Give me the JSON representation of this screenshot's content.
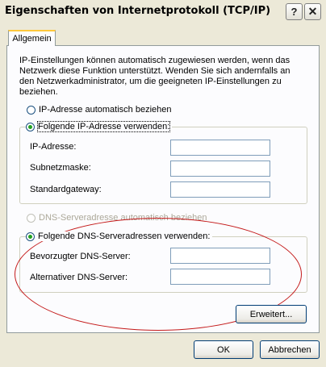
{
  "window": {
    "title": "Eigenschaften von Internetprotokoll (TCP/IP)",
    "help_icon": "?",
    "close_icon": "✕"
  },
  "tabs": [
    {
      "label": "Allgemein"
    }
  ],
  "intro_text": "IP-Einstellungen können automatisch zugewiesen werden, wenn das Netzwerk diese Funktion unterstützt. Wenden Sie sich andernfalls an den Netzwerkadministrator, um die geeigneten IP-Einstellungen zu beziehen.",
  "ip": {
    "auto_label": "IP-Adresse automatisch beziehen",
    "manual_label": "Folgende IP-Adresse verwenden:",
    "selected": "manual",
    "fields": [
      {
        "label": "IP-Adresse:",
        "value": ""
      },
      {
        "label": "Subnetzmaske:",
        "value": ""
      },
      {
        "label": "Standardgateway:",
        "value": ""
      }
    ]
  },
  "dns": {
    "auto_label": "DNS-Serveradresse automatisch beziehen",
    "manual_label": "Folgende DNS-Serveradressen verwenden:",
    "selected": "manual",
    "fields": [
      {
        "label": "Bevorzugter DNS-Server:",
        "value": ""
      },
      {
        "label": "Alternativer DNS-Server:",
        "value": ""
      }
    ]
  },
  "buttons": {
    "advanced": "Erweitert...",
    "ok": "OK",
    "cancel": "Abbrechen"
  },
  "colors": {
    "radio_selected": "#21a121",
    "annotation_ellipse": "#c41a1a"
  }
}
